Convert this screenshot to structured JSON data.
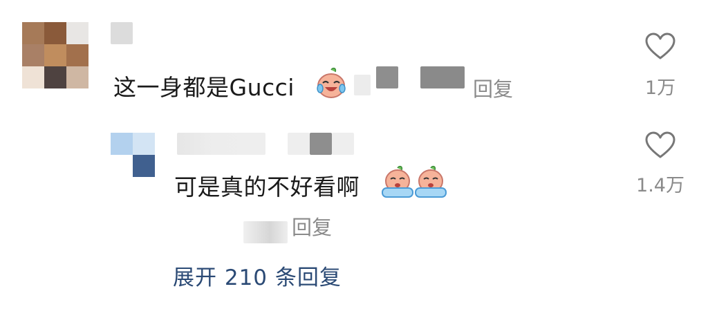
{
  "comment": {
    "text": "这一身都是Gucci",
    "emoji": "laughing-crying-emoji",
    "reply_label": "回复",
    "like_count": "1万"
  },
  "reply": {
    "text": "可是真的不好看啊",
    "emojis": [
      "crying-emoji",
      "crying-emoji"
    ],
    "reply_label": "回复",
    "like_count": "1.4万"
  },
  "expand": {
    "label": "展开 210 条回复"
  },
  "colors": {
    "link": "#2b4a75",
    "meta": "#8a8a8a",
    "text": "#1a1a1a"
  },
  "icons": {
    "like": "heart-outline-icon"
  }
}
